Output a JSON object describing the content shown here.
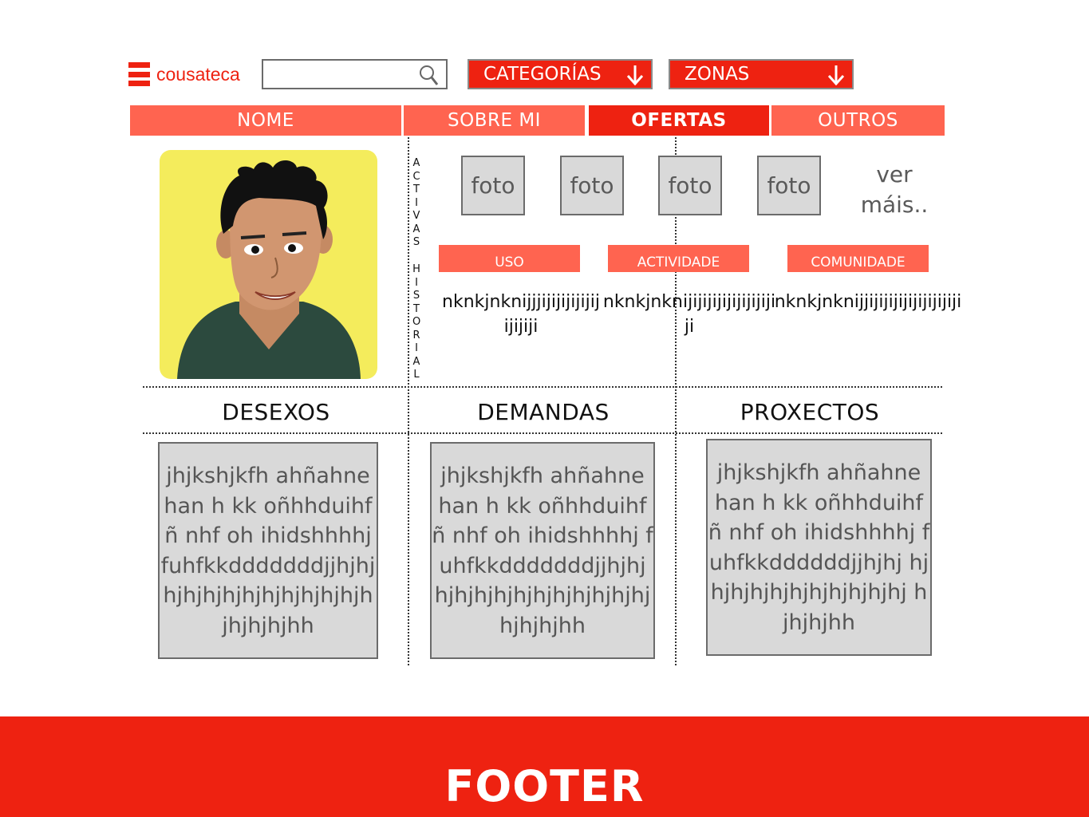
{
  "header": {
    "logo_text": "cousateca",
    "search": {
      "value": "",
      "placeholder": ""
    },
    "categories_label": "CATEGORÍAS",
    "zones_label": "ZONAS"
  },
  "tabs": [
    {
      "label": "NOME",
      "active": false
    },
    {
      "label": "SOBRE MI",
      "active": false
    },
    {
      "label": "OFERTAS",
      "active": true
    },
    {
      "label": "OUTROS",
      "active": false
    }
  ],
  "side_labels": {
    "activas": "ACTIVAS",
    "historial": "HISTORIAL"
  },
  "photos": [
    "foto",
    "foto",
    "foto",
    "foto"
  ],
  "see_more": "ver máis..",
  "badges": [
    "USO",
    "ACTIVIDADE",
    "COMUNIDADE"
  ],
  "scribbles": [
    "nknkjnknijjjijijijijijijijijiji",
    "nknkjnknijijijijijijijijijiji",
    "nknkjnknijjijijijijijijijijiji"
  ],
  "sections": [
    "DESEXOS",
    "DEMANDAS",
    "PROXECTOS"
  ],
  "cards": [
    "jhjkshjkfh ahñahne han h kk oñhhduihf ñ nhf oh ihidshhhhj fuhfkkdddddddjjhjhj hjhjhjhjhjhjhjhjhjhjh jhjhjhjhh",
    "jhjkshjkfh ahñahne han h kk oñhhduihf ñ nhf oh ihidshhhhj fuhfkkdddddddjjhjhj hjhjhjhjhjhjhjhjhjhjhj hjhjhjhh",
    "jhjkshjkfh ahñahne han h kk oñhhduihf ñ nhf oh ihidshhhhj fuhfkkddddddjjhjhj hjhjhjhjhjhjhjhjhjhjhj hjhjhjhh"
  ],
  "footer": "FOOTER",
  "colors": {
    "primary": "#ee2211",
    "secondary": "#ff6450",
    "placeholder_gray": "#d9d9d9"
  }
}
